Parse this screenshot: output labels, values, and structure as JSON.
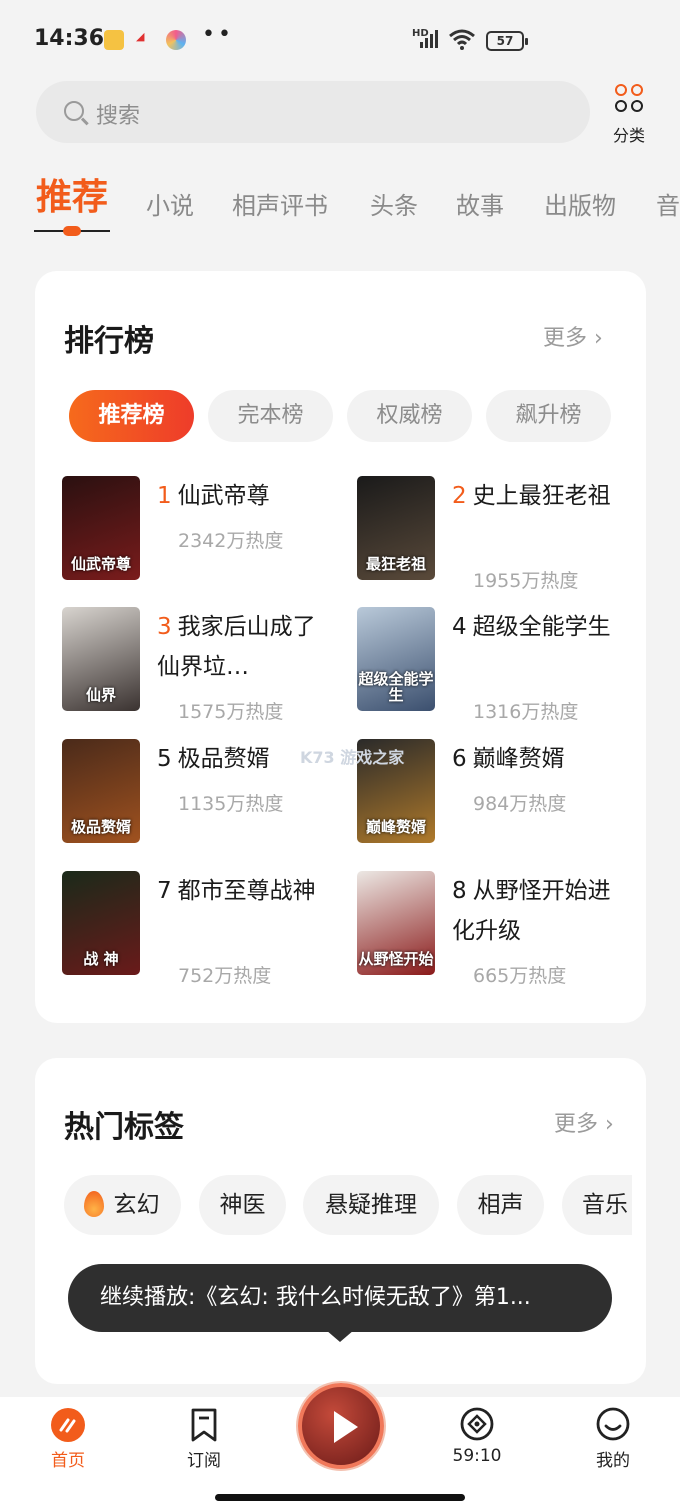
{
  "status_bar": {
    "time": "14:36",
    "battery": "57",
    "network": "HD"
  },
  "search": {
    "placeholder": "搜索"
  },
  "category_button": {
    "label": "分类"
  },
  "tabs": [
    "推荐",
    "小说",
    "相声评书",
    "头条",
    "故事",
    "出版物",
    "音"
  ],
  "ranking": {
    "title": "排行榜",
    "more": "更多 ›",
    "filters": [
      "推荐榜",
      "完本榜",
      "权威榜",
      "飙升榜"
    ],
    "active_filter": "推荐榜",
    "books": [
      {
        "rank": "1",
        "title": "仙武帝尊",
        "heat": "2342万热度",
        "cover_text": "仙武帝尊",
        "colors": [
          "#2a1010",
          "#7a1c1c"
        ]
      },
      {
        "rank": "2",
        "title": "史上最狂老祖",
        "heat": "1955万热度",
        "cover_text": "最狂老祖",
        "colors": [
          "#1a1a1a",
          "#5a4a3a"
        ]
      },
      {
        "rank": "3",
        "title": "我家后山成了仙界垃…",
        "heat": "1575万热度",
        "cover_text": "仙界",
        "colors": [
          "#d8d4cf",
          "#3a3230"
        ]
      },
      {
        "rank": "4",
        "title": "超级全能学生",
        "heat": "1316万热度",
        "cover_text": "超级全能学生",
        "colors": [
          "#b9c9d9",
          "#3b4f6e"
        ]
      },
      {
        "rank": "5",
        "title": "极品赘婿",
        "heat": "1135万热度",
        "cover_text": "极品赘婿",
        "colors": [
          "#4a2a1a",
          "#a0521f"
        ]
      },
      {
        "rank": "6",
        "title": "巅峰赘婿",
        "heat": "984万热度",
        "cover_text": "巅峰赘婿",
        "colors": [
          "#2a2a2a",
          "#b07a2a"
        ]
      },
      {
        "rank": "7",
        "title": "都市至尊战神",
        "heat": "752万热度",
        "cover_text": "战 神",
        "colors": [
          "#1a2a1a",
          "#6a1a1a"
        ]
      },
      {
        "rank": "8",
        "title": "从野怪开始进化升级",
        "heat": "665万热度",
        "cover_text": "从野怪开始",
        "colors": [
          "#ece8e4",
          "#8a1a1a"
        ]
      }
    ]
  },
  "hot_tags": {
    "title": "热门标签",
    "more": "更多 ›",
    "tags": [
      "玄幻",
      "神医",
      "悬疑推理",
      "相声",
      "音乐"
    ]
  },
  "toast": {
    "text": "继续播放:《玄幻: 我什么时候无敌了》第1..."
  },
  "bottom_nav": {
    "home": "首页",
    "subscribe": "订阅",
    "timer": "59:10",
    "mine": "我的"
  },
  "colors": {
    "accent": "#f25c1b",
    "card": "#ffffff",
    "background": "#f3f3f3"
  }
}
